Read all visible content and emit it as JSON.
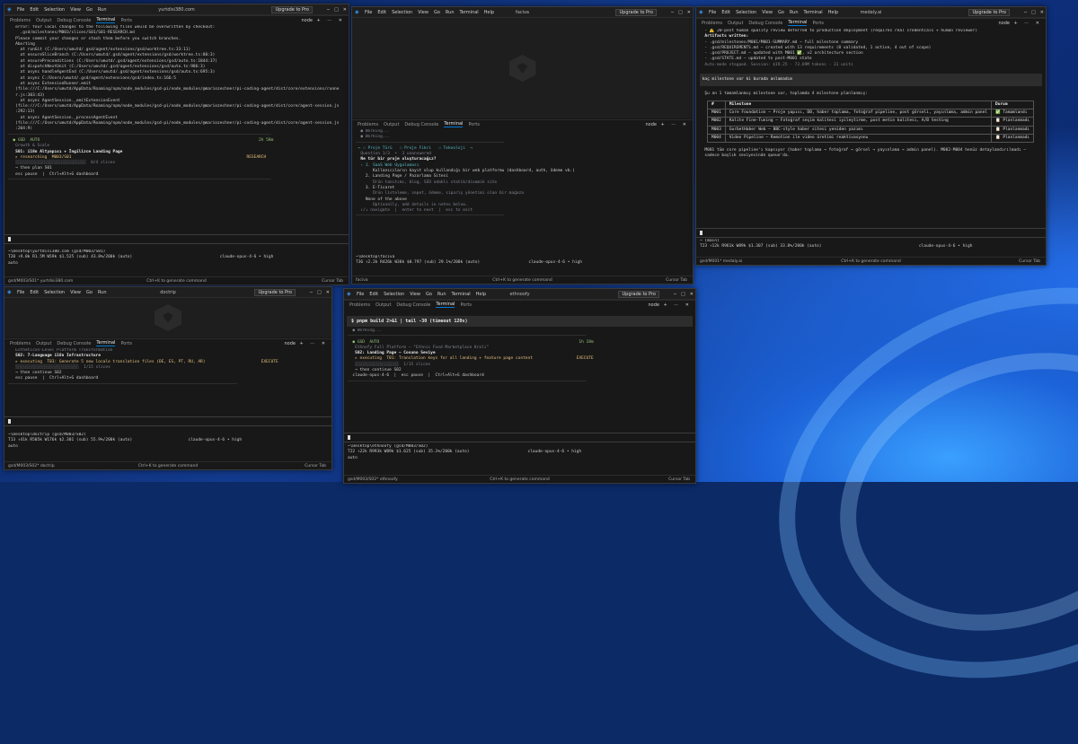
{
  "menu": [
    "File",
    "Edit",
    "Selection",
    "View",
    "Go",
    "Run",
    "Terminal",
    "Help"
  ],
  "menu_short": [
    "File",
    "Edit",
    "Selection",
    "View",
    "Go",
    "Run"
  ],
  "upgrade": "Upgrade to Pro",
  "panel_tabs": [
    "Problems",
    "Output",
    "Debug Console",
    "Terminal",
    "Ports"
  ],
  "node": "node",
  "statusbar_mid": "Ctrl+K to generate command",
  "w1": {
    "title": "yurtdisi380.com",
    "lines": [
      {
        "t": "   error: Your local changes to the following files would be overwritten by checkout:",
        "k": ""
      },
      {
        "t": "     .gsd/milestones/M003/slices/S01/S01-RESEARCH.md",
        "k": ""
      },
      {
        "t": "   Please commit your changes or stash them before you switch branches.",
        "k": ""
      },
      {
        "t": "   Aborting",
        "k": ""
      },
      {
        "t": "",
        "k": ""
      },
      {
        "t": "     at runGit (C:/Users/umutd/.gsd/agent/extensions/gsd/worktree.ts:33:11)",
        "k": ""
      },
      {
        "t": "     at ensureSliceBranch (C:/Users/umutd/.gsd/agent/extensions/gsd/worktree.ts:80:3)",
        "k": ""
      },
      {
        "t": "     at ensurePreconditions (C:/Users/umutd/.gsd/agent/extensions/gsd/auto.ts:1844:37)",
        "k": ""
      },
      {
        "t": "     at dispatchNextUnit (C:/Users/umutd/.gsd/agent/extensions/gsd/auto.ts:986:3)",
        "k": ""
      },
      {
        "t": "     at async handleAgentEnd (C:/Users/umutd/.gsd/agent/extensions/gsd/auto.ts:695:3)",
        "k": ""
      },
      {
        "t": "     at async C:/Users/umutd/.gsd/agent/extensions/gsd/index.ts:166:5",
        "k": ""
      },
      {
        "t": "     at async ExtensionRunner.emit",
        "k": ""
      },
      {
        "t": "   (file:///C:/Users/umutd/AppData/Roaming/npm/node_modules/gsd-pi/node_modules/@mariozechner/pi-coding-agent/dist/core/extensions/runne",
        "k": ""
      },
      {
        "t": "   r.js:303:43)",
        "k": ""
      },
      {
        "t": "     at async AgentSession._emitExtensionEvent",
        "k": ""
      },
      {
        "t": "   (file:///C:/Users/umutd/AppData/Roaming/npm/node_modules/gsd-pi/node_modules/@mariozechner/pi-coding-agent/dist/core/agent-session.js",
        "k": ""
      },
      {
        "t": "   :292:13)",
        "k": ""
      },
      {
        "t": "     at async AgentSession._processAgentEvent",
        "k": ""
      },
      {
        "t": "   (file:///C:/Users/umutd/AppData/Roaming/npm/node_modules/gsd-pi/node_modules/@mariozechner/pi-coding-agent/dist/core/agent-session.js",
        "k": ""
      },
      {
        "t": "   :204:9)",
        "k": ""
      },
      {
        "t": "────────────────────────────────────────────────────────────────────────────────────────────────────────────",
        "k": "sep"
      },
      {
        "t": "  ● GSD  AUTO                                                                                          2h 58m",
        "k": "g"
      },
      {
        "t": "",
        "k": ""
      },
      {
        "t": "   Growth & Scale",
        "k": "d"
      },
      {
        "t": "   S01: i18n Altyapısı + İngilizce Landing Page",
        "k": "b"
      },
      {
        "t": "",
        "k": ""
      },
      {
        "t": "   ▸ researching  M003/S01                                                                        RESEARCH",
        "k": "y"
      },
      {
        "t": "",
        "k": ""
      },
      {
        "t": "   ░░░░░░░░░░░░░░░░░░░░░░░░░░░░░  0/4 slices",
        "k": "d"
      },
      {
        "t": "",
        "k": ""
      },
      {
        "t": "   → then plan S01",
        "k": ""
      },
      {
        "t": "   esc pause  |  Ctrl+Alt+G dashboard",
        "k": ""
      },
      {
        "t": "────────────────────────────────────────────────────────────────────────────────────────────────────────────",
        "k": "sep"
      }
    ],
    "prompt": [
      {
        "t": "~\\Desktop\\yurtdisi380.com (gsd/M003/S01)",
        "k": ""
      },
      {
        "t": "T20 ↑9.0k R1.5M W59k $1.525 (sub) 43.8%/200k (auto)                                    claude-opus-4-6 • high",
        "k": ""
      },
      {
        "t": "auto",
        "k": ""
      }
    ],
    "status_l": "gsd/M003/S01*  yurtdisi380.com",
    "status_r": "Cursor Tab"
  },
  "w2": {
    "title": "faciva",
    "lines": [
      {
        "t": "  ● Working...",
        "k": "d"
      },
      {
        "t": "",
        "k": ""
      },
      {
        "t": "  ● Working...",
        "k": "d"
      },
      {
        "t": "─────────────────────────────────────────────────────────────",
        "k": "sep"
      },
      {
        "t": " ← ☐ Proje Türü   ☐ Proje Fikri   ☐ Teknoloji  →",
        "k": "c"
      },
      {
        "t": "",
        "k": ""
      },
      {
        "t": "  Question 1/3  •  3 unanswered",
        "k": "d"
      },
      {
        "t": "",
        "k": ""
      },
      {
        "t": "  Ne tür bir proje oluşturacağız?",
        "k": "b"
      },
      {
        "t": "",
        "k": ""
      },
      {
        "t": "  › 1. SaaS Web Uygulaması",
        "k": "c"
      },
      {
        "t": "       Kullanıcıların kayıt olup kullandığı bir web platformu (dashboard, auth, ödeme vb.)",
        "k": ""
      },
      {
        "t": "    2. Landing Page / Pazarlama Sitesi",
        "k": ""
      },
      {
        "t": "       Ürün tanıtımı, blog, SEO odaklı statik/dinamik site",
        "k": "d"
      },
      {
        "t": "    3. E-Ticaret",
        "k": ""
      },
      {
        "t": "       Ürün listeleme, sepet, ödeme, sipariş yönetimi olan bir mağaza",
        "k": "d"
      },
      {
        "t": "    None of the above",
        "k": ""
      },
      {
        "t": "       Optionally, add details in notes below.",
        "k": "d"
      },
      {
        "t": "",
        "k": ""
      },
      {
        "t": "  ↑/↓ navigate  |  enter to next  |  esc to exit",
        "k": "d"
      },
      {
        "t": "─────────────────────────────────────────────────────────────",
        "k": "sep"
      },
      {
        "t": "",
        "k": ""
      }
    ],
    "prompt": [
      {
        "t": "~\\Desktop\\faciva",
        "k": ""
      },
      {
        "t": "T36 ↑2.2k R426k W38k $0.797 (sub) 29.1%/200k (auto)                    claude-opus-4-6 • high",
        "k": ""
      }
    ],
    "status_l": "faciva",
    "status_r": "Cursor Tab"
  },
  "w3": {
    "title": "medaly.ai",
    "top": [
      {
        "t": "  - ⚠️ 20-post human quality review deferred to production deployment (requires real credentials + human reviewer)",
        "k": ""
      },
      {
        "t": "",
        "k": ""
      },
      {
        "t": "  Artifacts written:",
        "k": "b"
      },
      {
        "t": "  - .gsd/milestones/M001/M001-SUMMARY.md — full milestone summary",
        "k": ""
      },
      {
        "t": "  - .gsd/REQUIREMENTS.md — created with 13 requirements (8 validated, 1 active, 4 out of scope)",
        "k": ""
      },
      {
        "t": "  - .gsd/PROJECT.md — updated with M001 ✅, v2 architecture section",
        "k": ""
      },
      {
        "t": "  - .gsd/STATE.md — updated to post-M001 state",
        "k": ""
      },
      {
        "t": "",
        "k": ""
      },
      {
        "t": "  Auto-mode stopped. Session: $19.25 · 73.69M tokens · 31 units",
        "k": "d"
      }
    ],
    "user_msg": " kaç milestone var ki burada anlamadım",
    "intro": "  Şu an 1 tamamlanmış milestone var, toplamda 4 milestone planlanmış:",
    "table_head": [
      "#",
      "Milestone",
      "Durum"
    ],
    "table_rows": [
      [
        "M001",
        "Core Foundation — Proje yapısı, DB, haber toplama, fotoğraf pipeline, post görseli, yayınlama, admin panel",
        "✅ Tamamlandı"
      ],
      [
        "M002",
        "Kalite Fine-Tuning — Fotoğraf seçim kalitesi iyileştirme, post metin kalitesi, A/B testing",
        "📋 Planlanmadı"
      ],
      [
        "M003",
        "GurbetHaber Web — BBC-style haber sitesi yeniden yazımı",
        "📋 Planlanmadı"
      ],
      [
        "M004",
        "Video Pipeline — Remotion ile video üretimi reaktivasyonu",
        "📋 Planlanmadı"
      ]
    ],
    "outro": [
      {
        "t": "  M001 tüm core pipeline'ı kapsıyor (haber toplama → fotoğraf → görsel → yayınlama → admin panel). M002-M004 henüz detaylandırılmadı —",
        "k": ""
      },
      {
        "t": "  sadece başlık seviyesinde queue'da.",
        "k": ""
      }
    ],
    "prompt": [
      {
        "t": "─ (main)",
        "k": ""
      },
      {
        "t": "T23 ↑12k R961k W89k $1.307 (sub) 33.8%/200k (auto)                                        claude-opus-4-6 • high",
        "k": ""
      }
    ],
    "status_l": "gsd/M001*  medaly.ai",
    "status_r": "Cursor Tab"
  },
  "w4": {
    "title": "doctrip",
    "lines": [
      {
        "t": "",
        "k": ""
      },
      {
        "t": "   Esthetic̈on-Level Platform Transformation",
        "k": "d"
      },
      {
        "t": "   S02: 7-Language i18n Infrastructure",
        "k": "b"
      },
      {
        "t": "",
        "k": ""
      },
      {
        "t": "   ▸ executing  T03: Generate 5 new locale translation files (DE, ES, PT, RU, AR)                       EXECUTE",
        "k": "y"
      },
      {
        "t": "",
        "k": ""
      },
      {
        "t": "   ░░░░░░░░░░░░░░░░░░░░░░░░░░  1/15 slices",
        "k": "d"
      },
      {
        "t": "",
        "k": ""
      },
      {
        "t": "   → then continue S02",
        "k": ""
      },
      {
        "t": "   esc pause  |  Ctrl+Alt+G dashboard",
        "k": ""
      },
      {
        "t": "──────────────────────────────────────────────────────────────────────────────────────────────",
        "k": "sep"
      }
    ],
    "prompt": [
      {
        "t": "~\\Desktop\\doctrip (gsd/M003/S02)",
        "k": ""
      },
      {
        "t": "T13 ↑41k R505k W176k $2.301 (sub) 55.9%/200k (auto)                       claude-opus-4-6 • high",
        "k": ""
      },
      {
        "t": "auto",
        "k": ""
      }
    ],
    "status_l": "gsd/M003/S02*  doctrip",
    "status_r": "Cursor Tab"
  },
  "w5": {
    "title": "ethnoofy",
    "cmd": " $ pnpm build 2>&1 | tail -30 (timeout 120s)",
    "lines": [
      {
        "t": "",
        "k": ""
      },
      {
        "t": "  ● Working...",
        "k": "d"
      },
      {
        "t": "",
        "k": ""
      },
      {
        "t": "──────────────────────────────────────────────────────────────────────────────────────────────────",
        "k": "sep"
      },
      {
        "t": "  ● GSD  AUTO                                                                                  1h 18m",
        "k": "g"
      },
      {
        "t": "",
        "k": ""
      },
      {
        "t": "   Ethnofy Full Platform — \"Ethnic Food Marketplace Krali\"",
        "k": "d"
      },
      {
        "t": "   S02: Landing Page — Cosuno Seviye",
        "k": "b"
      },
      {
        "t": "",
        "k": ""
      },
      {
        "t": "   ▸ executing  T01: Translation keys for all landing + feature page content                  EXECUTE",
        "k": "y"
      },
      {
        "t": "",
        "k": ""
      },
      {
        "t": "   ░░░░░░░░░░░░░░░░░░  1/15 slices",
        "k": "d"
      },
      {
        "t": "",
        "k": ""
      },
      {
        "t": "   → then continue S02",
        "k": ""
      },
      {
        "t": "  claude-opus-4-6  |  esc pause  |  Ctrl+Alt+G dashboard",
        "k": ""
      },
      {
        "t": "──────────────────────────────────────────────────────────────────────────────────────────────────",
        "k": "sep"
      }
    ],
    "prompt": [
      {
        "t": "~\\Desktop\\ethnoofy (gsd/M003/S02)",
        "k": ""
      },
      {
        "t": "T22 ↑22k R993k W89k $1.625 (sub) 35.1%/200k (auto)                        claude-opus-4-6 • high",
        "k": ""
      },
      {
        "t": "auto",
        "k": ""
      }
    ],
    "status_l": "gsd/M003/S02*  ethnoofy",
    "status_r": "Cursor Tab"
  }
}
